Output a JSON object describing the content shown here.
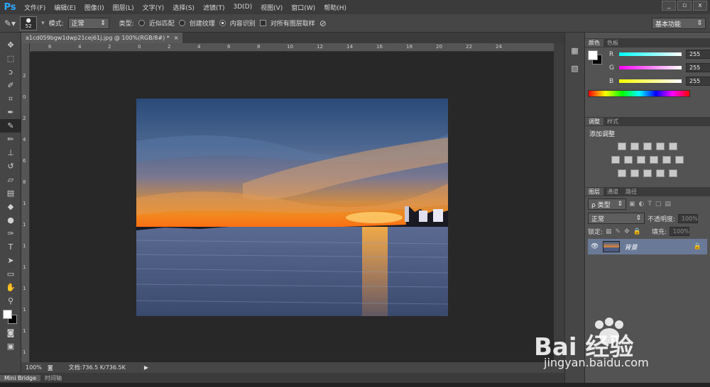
{
  "app": {
    "logo": "Ps"
  },
  "menu": [
    "文件(F)",
    "编辑(E)",
    "图像(I)",
    "图层(L)",
    "文字(Y)",
    "选择(S)",
    "滤镜(T)",
    "3D(D)",
    "视图(V)",
    "窗口(W)",
    "帮助(H)"
  ],
  "window_controls": [
    "_",
    "▫",
    "x"
  ],
  "options": {
    "brush_size": "52",
    "mode_label": "模式:",
    "mode_value": "正常",
    "type_label": "类型:",
    "radio1": "近似匹配",
    "radio2": "创建纹理",
    "radio3": "内容识别",
    "checkbox": "对所有图层取样",
    "workspace": "基本功能"
  },
  "document": {
    "tab_title": "a1cd059bgw1dwp21cej61j.jpg @ 100%(RGB/8#) *",
    "close": "×"
  },
  "ruler": {
    "h_labels": [
      "6",
      "4",
      "2",
      "0",
      "2",
      "4",
      "6",
      "8",
      "10",
      "12",
      "14",
      "16",
      "18",
      "20",
      "22",
      "24"
    ],
    "v_labels": [
      "2",
      "0",
      "2",
      "4",
      "6",
      "8",
      "1",
      "1",
      "1",
      "1",
      "1",
      "1",
      "1",
      "1"
    ]
  },
  "status": {
    "zoom": "100%",
    "doc": "文档:736.5 K/736.5K"
  },
  "bottom_tabs": [
    "Mini Bridge",
    "时间轴"
  ],
  "color_panel": {
    "tabs": [
      "颜色",
      "色板"
    ],
    "channels": [
      {
        "label": "R",
        "value": "255",
        "color": "#ff3a3a"
      },
      {
        "label": "G",
        "value": "255",
        "color": "#3aff3a"
      },
      {
        "label": "B",
        "value": "255",
        "color": "#3a3aff"
      }
    ]
  },
  "adjust_panel": {
    "tabs": [
      "调整",
      "样式"
    ],
    "title": "添加调整"
  },
  "layers_panel": {
    "tabs": [
      "图层",
      "通道",
      "路径"
    ],
    "filter": "ρ 类型",
    "blend": "正常",
    "opacity_label": "不透明度:",
    "opacity_value": "100%",
    "lock_label": "锁定:",
    "fill_label": "填充:",
    "fill_value": "100%",
    "layer_name": "背景"
  },
  "watermark": {
    "brand": "Bai 经验",
    "url": "jingyan.baidu.com"
  }
}
